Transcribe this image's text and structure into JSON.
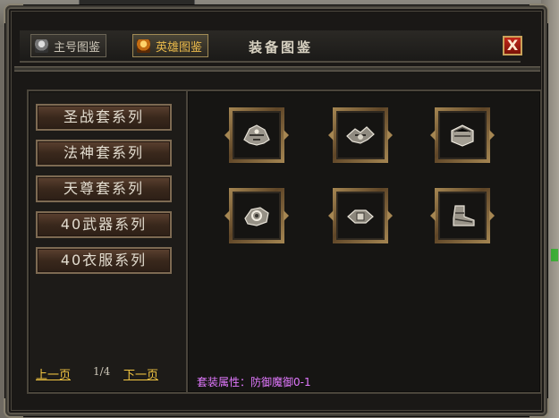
{
  "window": {
    "title": "装备图鉴",
    "close_label": "X"
  },
  "tabs": [
    {
      "label": "主号图鉴",
      "icon": "main-character-icon",
      "active": false
    },
    {
      "label": "英雄图鉴",
      "icon": "hero-icon",
      "active": true
    }
  ],
  "sidebar": {
    "items": [
      {
        "label": "圣战套系列"
      },
      {
        "label": "法神套系列"
      },
      {
        "label": "天尊套系列"
      },
      {
        "label": "40武器系列"
      },
      {
        "label": "40衣服系列"
      }
    ]
  },
  "pager": {
    "prev_label": "上一页",
    "page_text": "1/4",
    "next_label": "下一页"
  },
  "items": [
    {
      "icon": "helmet-icon"
    },
    {
      "icon": "necklace-icon"
    },
    {
      "icon": "bracelet-icon"
    },
    {
      "icon": "ring-icon"
    },
    {
      "icon": "belt-icon"
    },
    {
      "icon": "boots-icon"
    }
  ],
  "set_attribute": "套装属性：防御魔御0-1"
}
